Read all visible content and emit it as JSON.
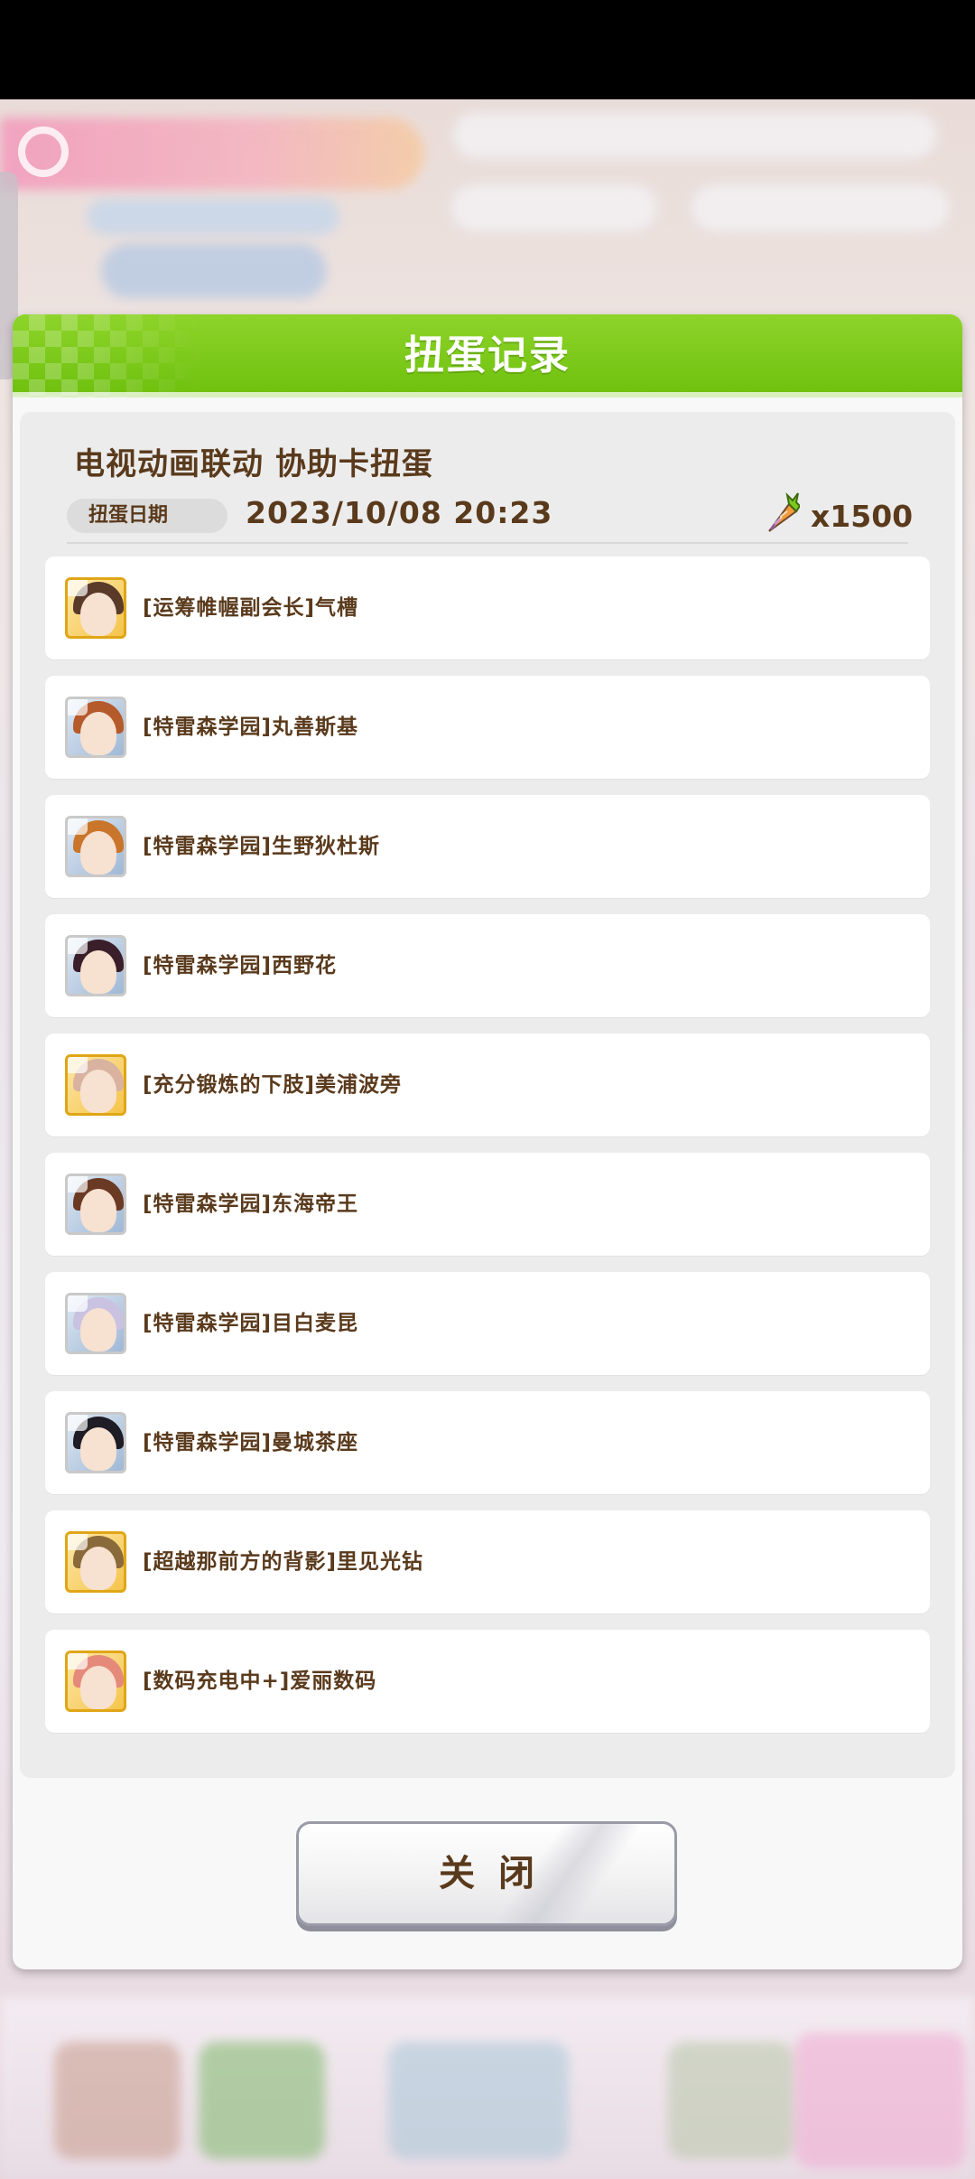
{
  "dialog": {
    "title": "扭蛋记录",
    "banner_name": "电视动画联动  协助卡扭蛋",
    "date_label": "扭蛋日期",
    "date_value": "2023/10/08  20:23",
    "cost_icon": "carrot-icon",
    "cost_value": "x1500",
    "close_label": "关闭"
  },
  "results": [
    {
      "label": "[运筹帷幄副会长]气槽",
      "frame": "gold",
      "hair": "#5a3b2a"
    },
    {
      "label": "[特雷森学园]丸善斯基",
      "frame": "silver",
      "hair": "#b55a2a"
    },
    {
      "label": "[特雷森学园]生野狄杜斯",
      "frame": "silver",
      "hair": "#c9762c"
    },
    {
      "label": "[特雷森学园]西野花",
      "frame": "silver",
      "hair": "#3a1f2a"
    },
    {
      "label": "[充分锻炼的下肢]美浦波旁",
      "frame": "gold",
      "hair": "#d9b3a0"
    },
    {
      "label": "[特雷森学园]东海帝王",
      "frame": "silver",
      "hair": "#6b3a24"
    },
    {
      "label": "[特雷森学园]目白麦昆",
      "frame": "silver",
      "hair": "#c9c2e0"
    },
    {
      "label": "[特雷森学园]曼城茶座",
      "frame": "silver",
      "hair": "#1e1c24"
    },
    {
      "label": "[超越那前方的背影]里见光钻",
      "frame": "gold",
      "hair": "#8a6a3a"
    },
    {
      "label": "[数码充电中+]爱丽数码",
      "frame": "gold",
      "hair": "#e58a7a"
    }
  ],
  "colors": {
    "header_green": "#7ccb1c",
    "text_brown": "#5a3a1c",
    "gold_frame": "#e0a617"
  }
}
